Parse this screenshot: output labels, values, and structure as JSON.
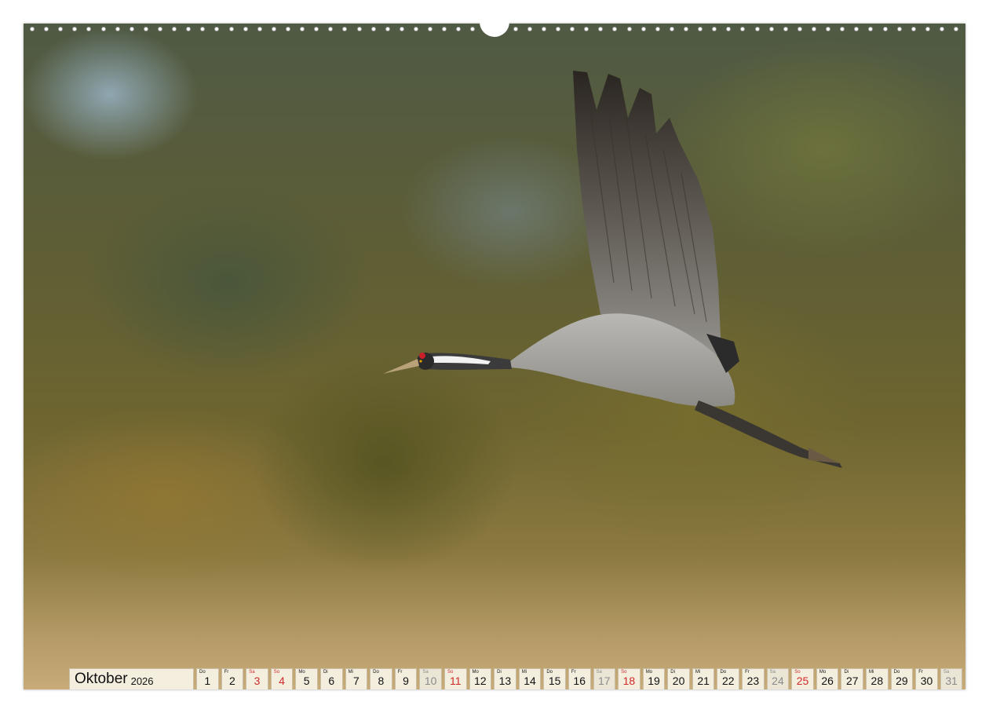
{
  "calendar": {
    "month": "Oktober",
    "year": "2026",
    "days": [
      {
        "wd": "Do",
        "n": "1",
        "type": "weekday"
      },
      {
        "wd": "Fr",
        "n": "2",
        "type": "weekday"
      },
      {
        "wd": "Sa",
        "n": "3",
        "type": "sun"
      },
      {
        "wd": "So",
        "n": "4",
        "type": "sun"
      },
      {
        "wd": "Mo",
        "n": "5",
        "type": "weekday"
      },
      {
        "wd": "Di",
        "n": "6",
        "type": "weekday"
      },
      {
        "wd": "Mi",
        "n": "7",
        "type": "weekday"
      },
      {
        "wd": "Do",
        "n": "8",
        "type": "weekday"
      },
      {
        "wd": "Fr",
        "n": "9",
        "type": "weekday"
      },
      {
        "wd": "Sa",
        "n": "10",
        "type": "sat"
      },
      {
        "wd": "So",
        "n": "11",
        "type": "sun"
      },
      {
        "wd": "Mo",
        "n": "12",
        "type": "weekday"
      },
      {
        "wd": "Di",
        "n": "13",
        "type": "weekday"
      },
      {
        "wd": "Mi",
        "n": "14",
        "type": "weekday"
      },
      {
        "wd": "Do",
        "n": "15",
        "type": "weekday"
      },
      {
        "wd": "Fr",
        "n": "16",
        "type": "weekday"
      },
      {
        "wd": "Sa",
        "n": "17",
        "type": "sat"
      },
      {
        "wd": "So",
        "n": "18",
        "type": "sun"
      },
      {
        "wd": "Mo",
        "n": "19",
        "type": "weekday"
      },
      {
        "wd": "Di",
        "n": "20",
        "type": "weekday"
      },
      {
        "wd": "Mi",
        "n": "21",
        "type": "weekday"
      },
      {
        "wd": "Do",
        "n": "22",
        "type": "weekday"
      },
      {
        "wd": "Fr",
        "n": "23",
        "type": "weekday"
      },
      {
        "wd": "Sa",
        "n": "24",
        "type": "sat"
      },
      {
        "wd": "So",
        "n": "25",
        "type": "sun"
      },
      {
        "wd": "Mo",
        "n": "26",
        "type": "weekday"
      },
      {
        "wd": "Di",
        "n": "27",
        "type": "weekday"
      },
      {
        "wd": "Mi",
        "n": "28",
        "type": "weekday"
      },
      {
        "wd": "Do",
        "n": "29",
        "type": "weekday"
      },
      {
        "wd": "Fr",
        "n": "30",
        "type": "weekday"
      },
      {
        "wd": "Sa",
        "n": "31",
        "type": "sat"
      }
    ]
  },
  "colors": {
    "cell_bg": "#f4eedf",
    "sunday_red": "#d0292b",
    "saturday_grey": "#8a8a8a"
  }
}
